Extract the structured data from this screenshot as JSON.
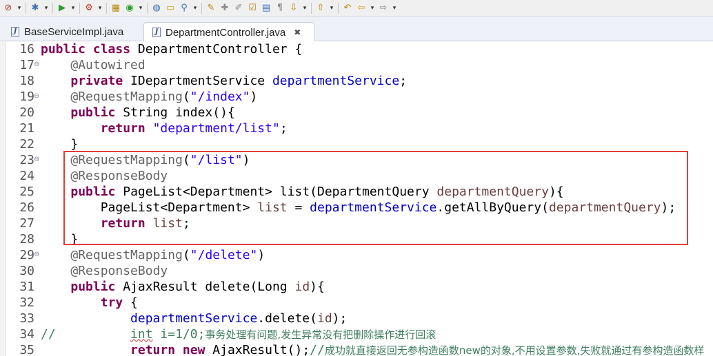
{
  "toolbar": {
    "icons": [
      "skip-breakpoints-icon",
      "dropdown-arrow-icon",
      "debug-icon",
      "dropdown-arrow-icon",
      "run-icon",
      "dropdown-arrow-icon",
      "external-tools-icon",
      "dropdown-arrow-icon",
      "new-package-icon",
      "new-class-icon",
      "dropdown-arrow-icon",
      "open-type-icon",
      "open-folder-icon",
      "search-icon",
      "dropdown-arrow-icon",
      "toggle-mark-icon",
      "pin-icon",
      "brush-icon",
      "task-icon",
      "document-icon",
      "paragraph-icon",
      "next-annotation-icon",
      "dropdown-arrow-icon",
      "prev-annotation-icon",
      "dropdown-arrow-icon",
      "last-edit-icon",
      "back-icon",
      "dropdown-arrow-icon",
      "forward-icon",
      "dropdown-arrow-icon"
    ]
  },
  "tabs": [
    {
      "label": "BaseServiceImpl.java",
      "active": false
    },
    {
      "label": "DepartmentController.java",
      "active": true,
      "close": "✖"
    }
  ],
  "editor": {
    "line_numbers": [
      "16",
      "17",
      "18",
      "19",
      "20",
      "21",
      "22",
      "23",
      "24",
      "25",
      "26",
      "27",
      "28",
      "29",
      "30",
      "31",
      "32",
      "33",
      "34",
      "35"
    ],
    "fold_markers": [
      "17",
      "19",
      "23",
      "29"
    ],
    "fold_glyph": "⊖",
    "highlight_lines": [
      "23",
      "28"
    ],
    "lines": [
      [
        {
          "t": "public",
          "c": "kw"
        },
        {
          "t": " "
        },
        {
          "t": "class",
          "c": "kw"
        },
        {
          "t": " DepartmentController {"
        }
      ],
      [
        {
          "t": "    "
        },
        {
          "t": "@Autowired",
          "c": "an"
        }
      ],
      [
        {
          "t": "    "
        },
        {
          "t": "private",
          "c": "kw"
        },
        {
          "t": " IDepartmentService "
        },
        {
          "t": "departmentService",
          "c": "fd"
        },
        {
          "t": ";"
        }
      ],
      [
        {
          "t": "    "
        },
        {
          "t": "@RequestMapping",
          "c": "an"
        },
        {
          "t": "("
        },
        {
          "t": "\"/index\"",
          "c": "st"
        },
        {
          "t": ")"
        }
      ],
      [
        {
          "t": "    "
        },
        {
          "t": "public",
          "c": "kw"
        },
        {
          "t": " String index(){"
        }
      ],
      [
        {
          "t": "        "
        },
        {
          "t": "return",
          "c": "kw"
        },
        {
          "t": " "
        },
        {
          "t": "\"department/list\"",
          "c": "st"
        },
        {
          "t": ";"
        }
      ],
      [
        {
          "t": "    }"
        }
      ],
      [
        {
          "t": "    "
        },
        {
          "t": "@RequestMapping",
          "c": "an"
        },
        {
          "t": "("
        },
        {
          "t": "\"/list\"",
          "c": "st"
        },
        {
          "t": ")"
        }
      ],
      [
        {
          "t": "    "
        },
        {
          "t": "@ResponseBody",
          "c": "an"
        }
      ],
      [
        {
          "t": "    "
        },
        {
          "t": "public",
          "c": "kw"
        },
        {
          "t": " PageList<Department> list(DepartmentQuery "
        },
        {
          "t": "departmentQuery",
          "c": "pv"
        },
        {
          "t": "){"
        }
      ],
      [
        {
          "t": "        PageList<Department> "
        },
        {
          "t": "list",
          "c": "pv"
        },
        {
          "t": " = "
        },
        {
          "t": "departmentService",
          "c": "fd"
        },
        {
          "t": ".getAllByQuery("
        },
        {
          "t": "departmentQuery",
          "c": "pv"
        },
        {
          "t": ");"
        }
      ],
      [
        {
          "t": "        "
        },
        {
          "t": "return",
          "c": "kw"
        },
        {
          "t": " "
        },
        {
          "t": "list",
          "c": "pv"
        },
        {
          "t": ";"
        }
      ],
      [
        {
          "t": "    }"
        }
      ],
      [
        {
          "t": "    "
        },
        {
          "t": "@RequestMapping",
          "c": "an"
        },
        {
          "t": "("
        },
        {
          "t": "\"/delete\"",
          "c": "st"
        },
        {
          "t": ")"
        }
      ],
      [
        {
          "t": "    "
        },
        {
          "t": "@ResponseBody",
          "c": "an"
        }
      ],
      [
        {
          "t": "    "
        },
        {
          "t": "public",
          "c": "kw"
        },
        {
          "t": " AjaxResult delete(Long "
        },
        {
          "t": "id",
          "c": "pv"
        },
        {
          "t": "){"
        }
      ],
      [
        {
          "t": "        "
        },
        {
          "t": "try",
          "c": "kw"
        },
        {
          "t": " {"
        }
      ],
      [
        {
          "t": "            "
        },
        {
          "t": "departmentService",
          "c": "fd"
        },
        {
          "t": ".delete("
        },
        {
          "t": "id",
          "c": "pv"
        },
        {
          "t": ");"
        }
      ],
      [
        {
          "t": "//          ",
          "c": "cm"
        },
        {
          "t": "int i=1/0;",
          "c": "cm"
        },
        {
          "t": "事务处理有问题,发生异常没有把删除操作进行回滚",
          "c": "cmcn"
        }
      ],
      [
        {
          "t": "            "
        },
        {
          "t": "return",
          "c": "kw"
        },
        {
          "t": " "
        },
        {
          "t": "new",
          "c": "kw"
        },
        {
          "t": " AjaxResult();"
        },
        {
          "t": "//",
          "c": "cm"
        },
        {
          "t": "成功就直接返回无参构造函数new的对象,不用设置参数,失败就通过有参构造函数样",
          "c": "cmcn"
        }
      ]
    ]
  }
}
